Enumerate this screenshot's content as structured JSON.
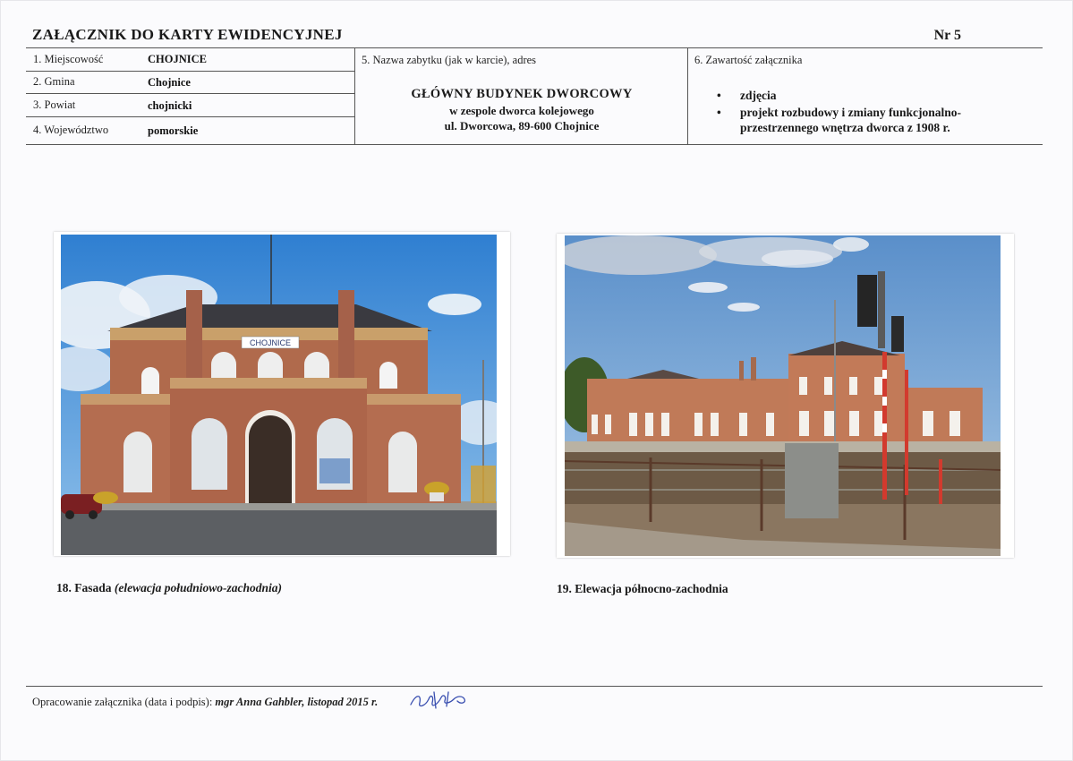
{
  "header": {
    "title": "ZAŁĄCZNIK DO KARTY EWIDENCYJNEJ",
    "number": "Nr 5"
  },
  "fields": {
    "miejscowosc_label": "1. Miejscowość",
    "miejscowosc_value": "CHOJNICE",
    "gmina_label": "2. Gmina",
    "gmina_value": "Chojnice",
    "powiat_label": "3. Powiat",
    "powiat_value": "chojnicki",
    "wojewodztwo_label": "4. Województwo",
    "wojewodztwo_value": "pomorskie",
    "nazwa_label": "5. Nazwa zabytku (jak w karcie), adres",
    "nazwa_line1": "GŁÓWNY BUDYNEK DWORCOWY",
    "nazwa_line2": "w zespole dworca kolejowego",
    "nazwa_line3": "ul. Dworcowa, 89-600 Chojnice",
    "zawartosc_label": "6. Zawartość załącznika",
    "zawartosc_items": [
      {
        "bullet": "•",
        "line1": "zdjęcia",
        "line2": ""
      },
      {
        "bullet": "•",
        "line1": "projekt rozbudowy i zmiany funkcjonalno-",
        "line2": "przestrzennego wnętrza dworca z 1908 r."
      }
    ]
  },
  "photos": [
    {
      "sign_text": "CHOJNICE",
      "caption_prefix": "18. Fasada ",
      "caption_italic": "(elewacja południowo-zachodnia)"
    },
    {
      "caption_prefix": "19. Elewacja północno-zachodnia",
      "caption_italic": ""
    }
  ],
  "footer": {
    "label": "Opracowanie załącznika (data i podpis): ",
    "author": "mgr Anna Gahbler, listopad 2015 r."
  },
  "colors": {
    "rule": "#555555",
    "signature_ink": "#3a4fb0"
  }
}
